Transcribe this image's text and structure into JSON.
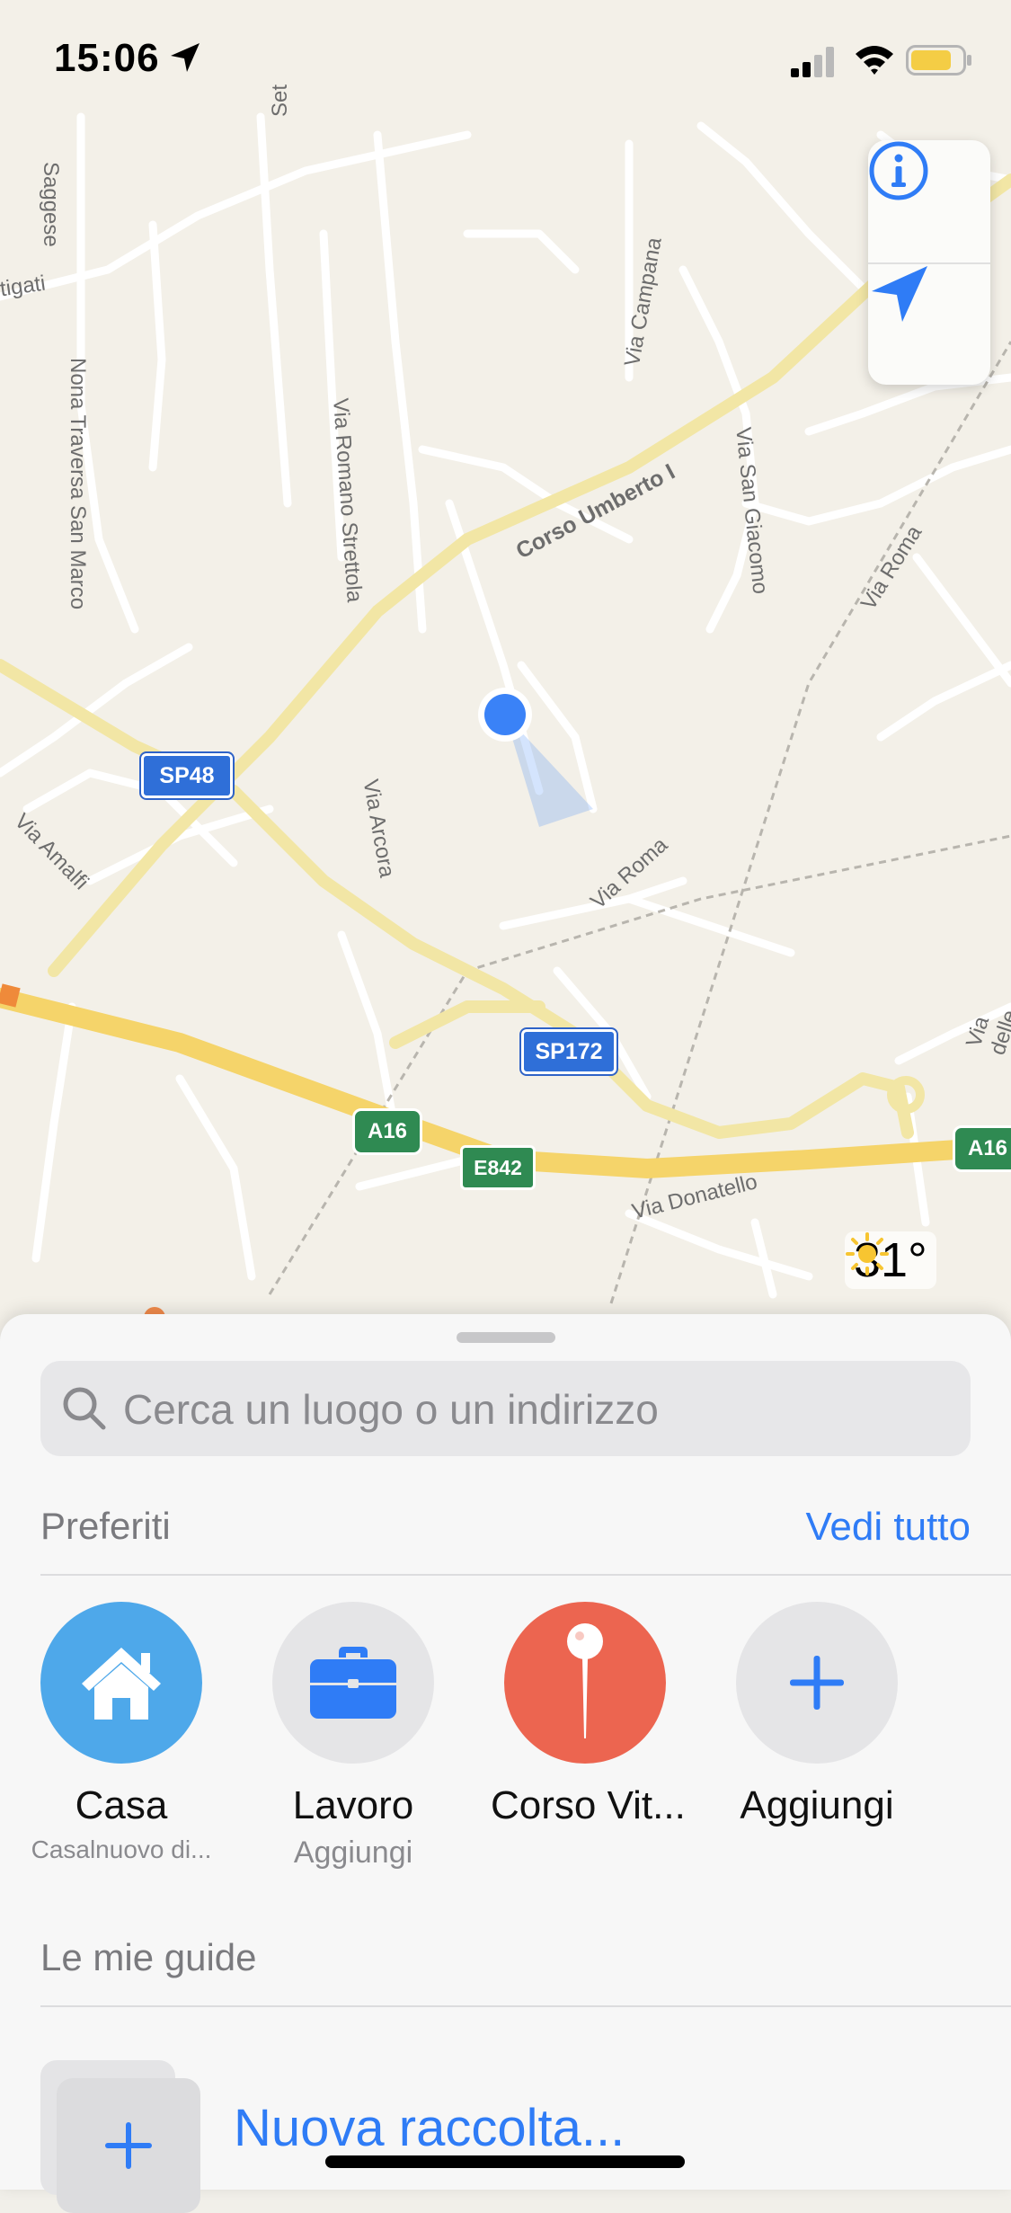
{
  "status_bar": {
    "time": "15:06"
  },
  "map": {
    "street_labels": [
      "Saggese",
      "Set",
      "tigati",
      "Via Campana",
      "Nona Traversa San Marco",
      "Via Romano Strettola",
      "Corso Umberto I",
      "Via San Giacomo",
      "Via Roma",
      "Via Arcora",
      "Via Amalfi",
      "Via delle Ginestre",
      "Via Donatello"
    ],
    "shields": {
      "sp48": "SP48",
      "sp172": "SP172",
      "a16_left": "A16",
      "a16_right": "A16",
      "e842": "E842"
    },
    "weather": {
      "temp": "31°",
      "icon": "sun-icon"
    },
    "controls": {
      "info": "info-icon",
      "locate": "location-arrow-icon"
    }
  },
  "sheet": {
    "search": {
      "placeholder": "Cerca un luogo o un indirizzo"
    },
    "favorites": {
      "title": "Preferiti",
      "see_all": "Vedi tutto",
      "items": [
        {
          "label": "Casa",
          "sub": "Casalnuovo di...",
          "icon": "house-icon",
          "color": "#4ea8ea"
        },
        {
          "label": "Lavoro",
          "sub": "Aggiungi",
          "icon": "briefcase-icon",
          "color": "#e5e5e7"
        },
        {
          "label": "Corso Vit...",
          "sub": "",
          "icon": "pin-icon",
          "color": "#ec6550"
        },
        {
          "label": "Aggiungi",
          "sub": "",
          "icon": "plus-icon",
          "color": "#e5e5e7"
        }
      ]
    },
    "guides": {
      "title": "Le mie guide",
      "new_collection": "Nuova raccolta..."
    }
  },
  "colors": {
    "accent": "#2f7cf6",
    "highway": "#f5d46a",
    "location_dot": "#3a82f7"
  }
}
